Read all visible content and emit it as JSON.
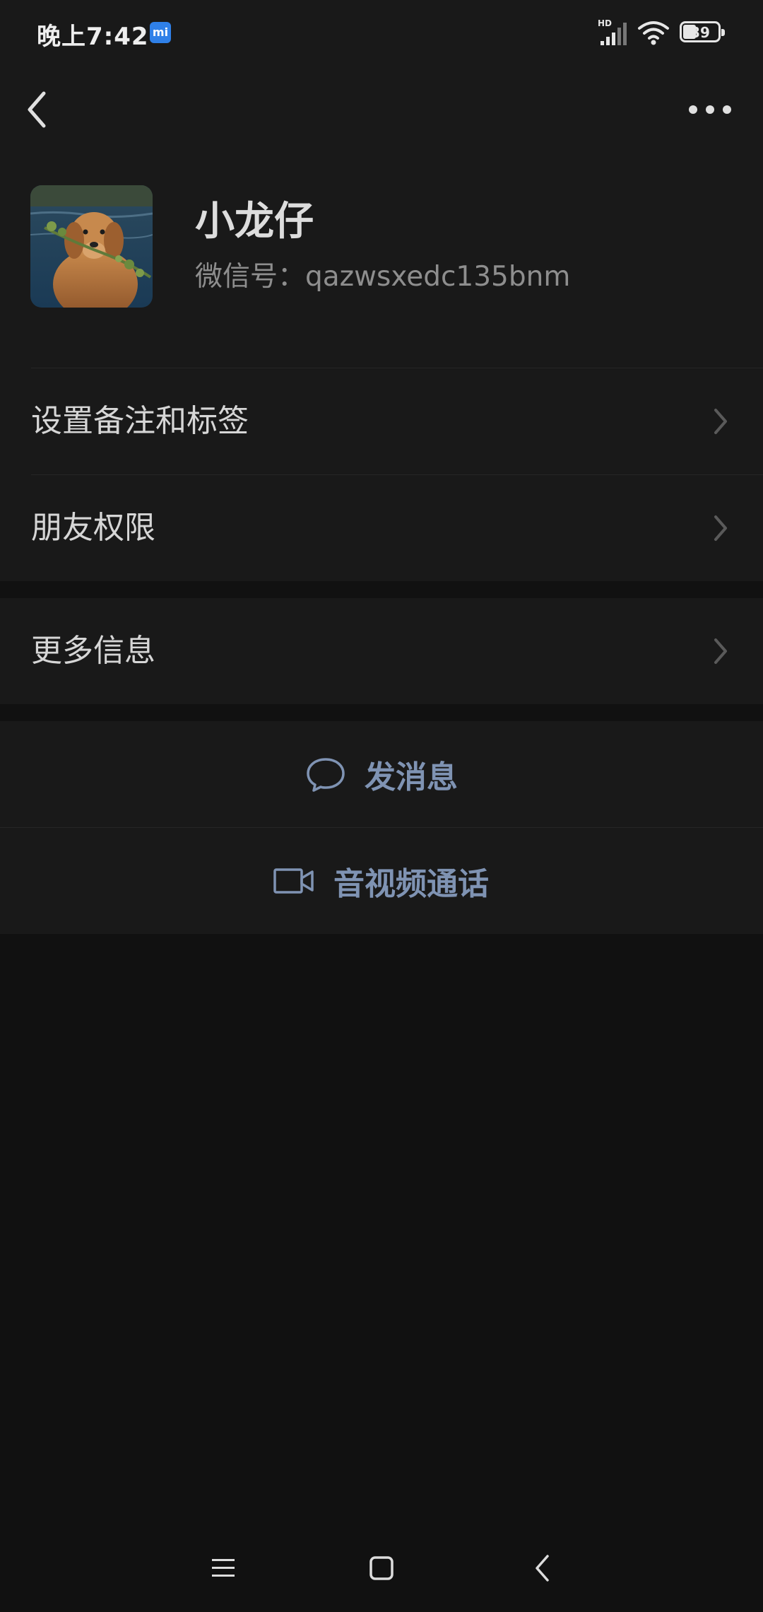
{
  "status_bar": {
    "time": "晚上7:42",
    "app_badge": "mi",
    "network": "HD",
    "battery_level": "39"
  },
  "profile": {
    "name": "小龙仔",
    "wechat_id": "微信号：qazwsxedc135bnm"
  },
  "menu": {
    "remark_and_tags": "设置备注和标签",
    "friend_permissions": "朋友权限",
    "more_info": "更多信息"
  },
  "actions": {
    "send_message": "发消息",
    "video_call": "音视频通话"
  },
  "colors": {
    "background": "#111111",
    "surface": "#191919",
    "accent_link": "#7f93b3"
  }
}
